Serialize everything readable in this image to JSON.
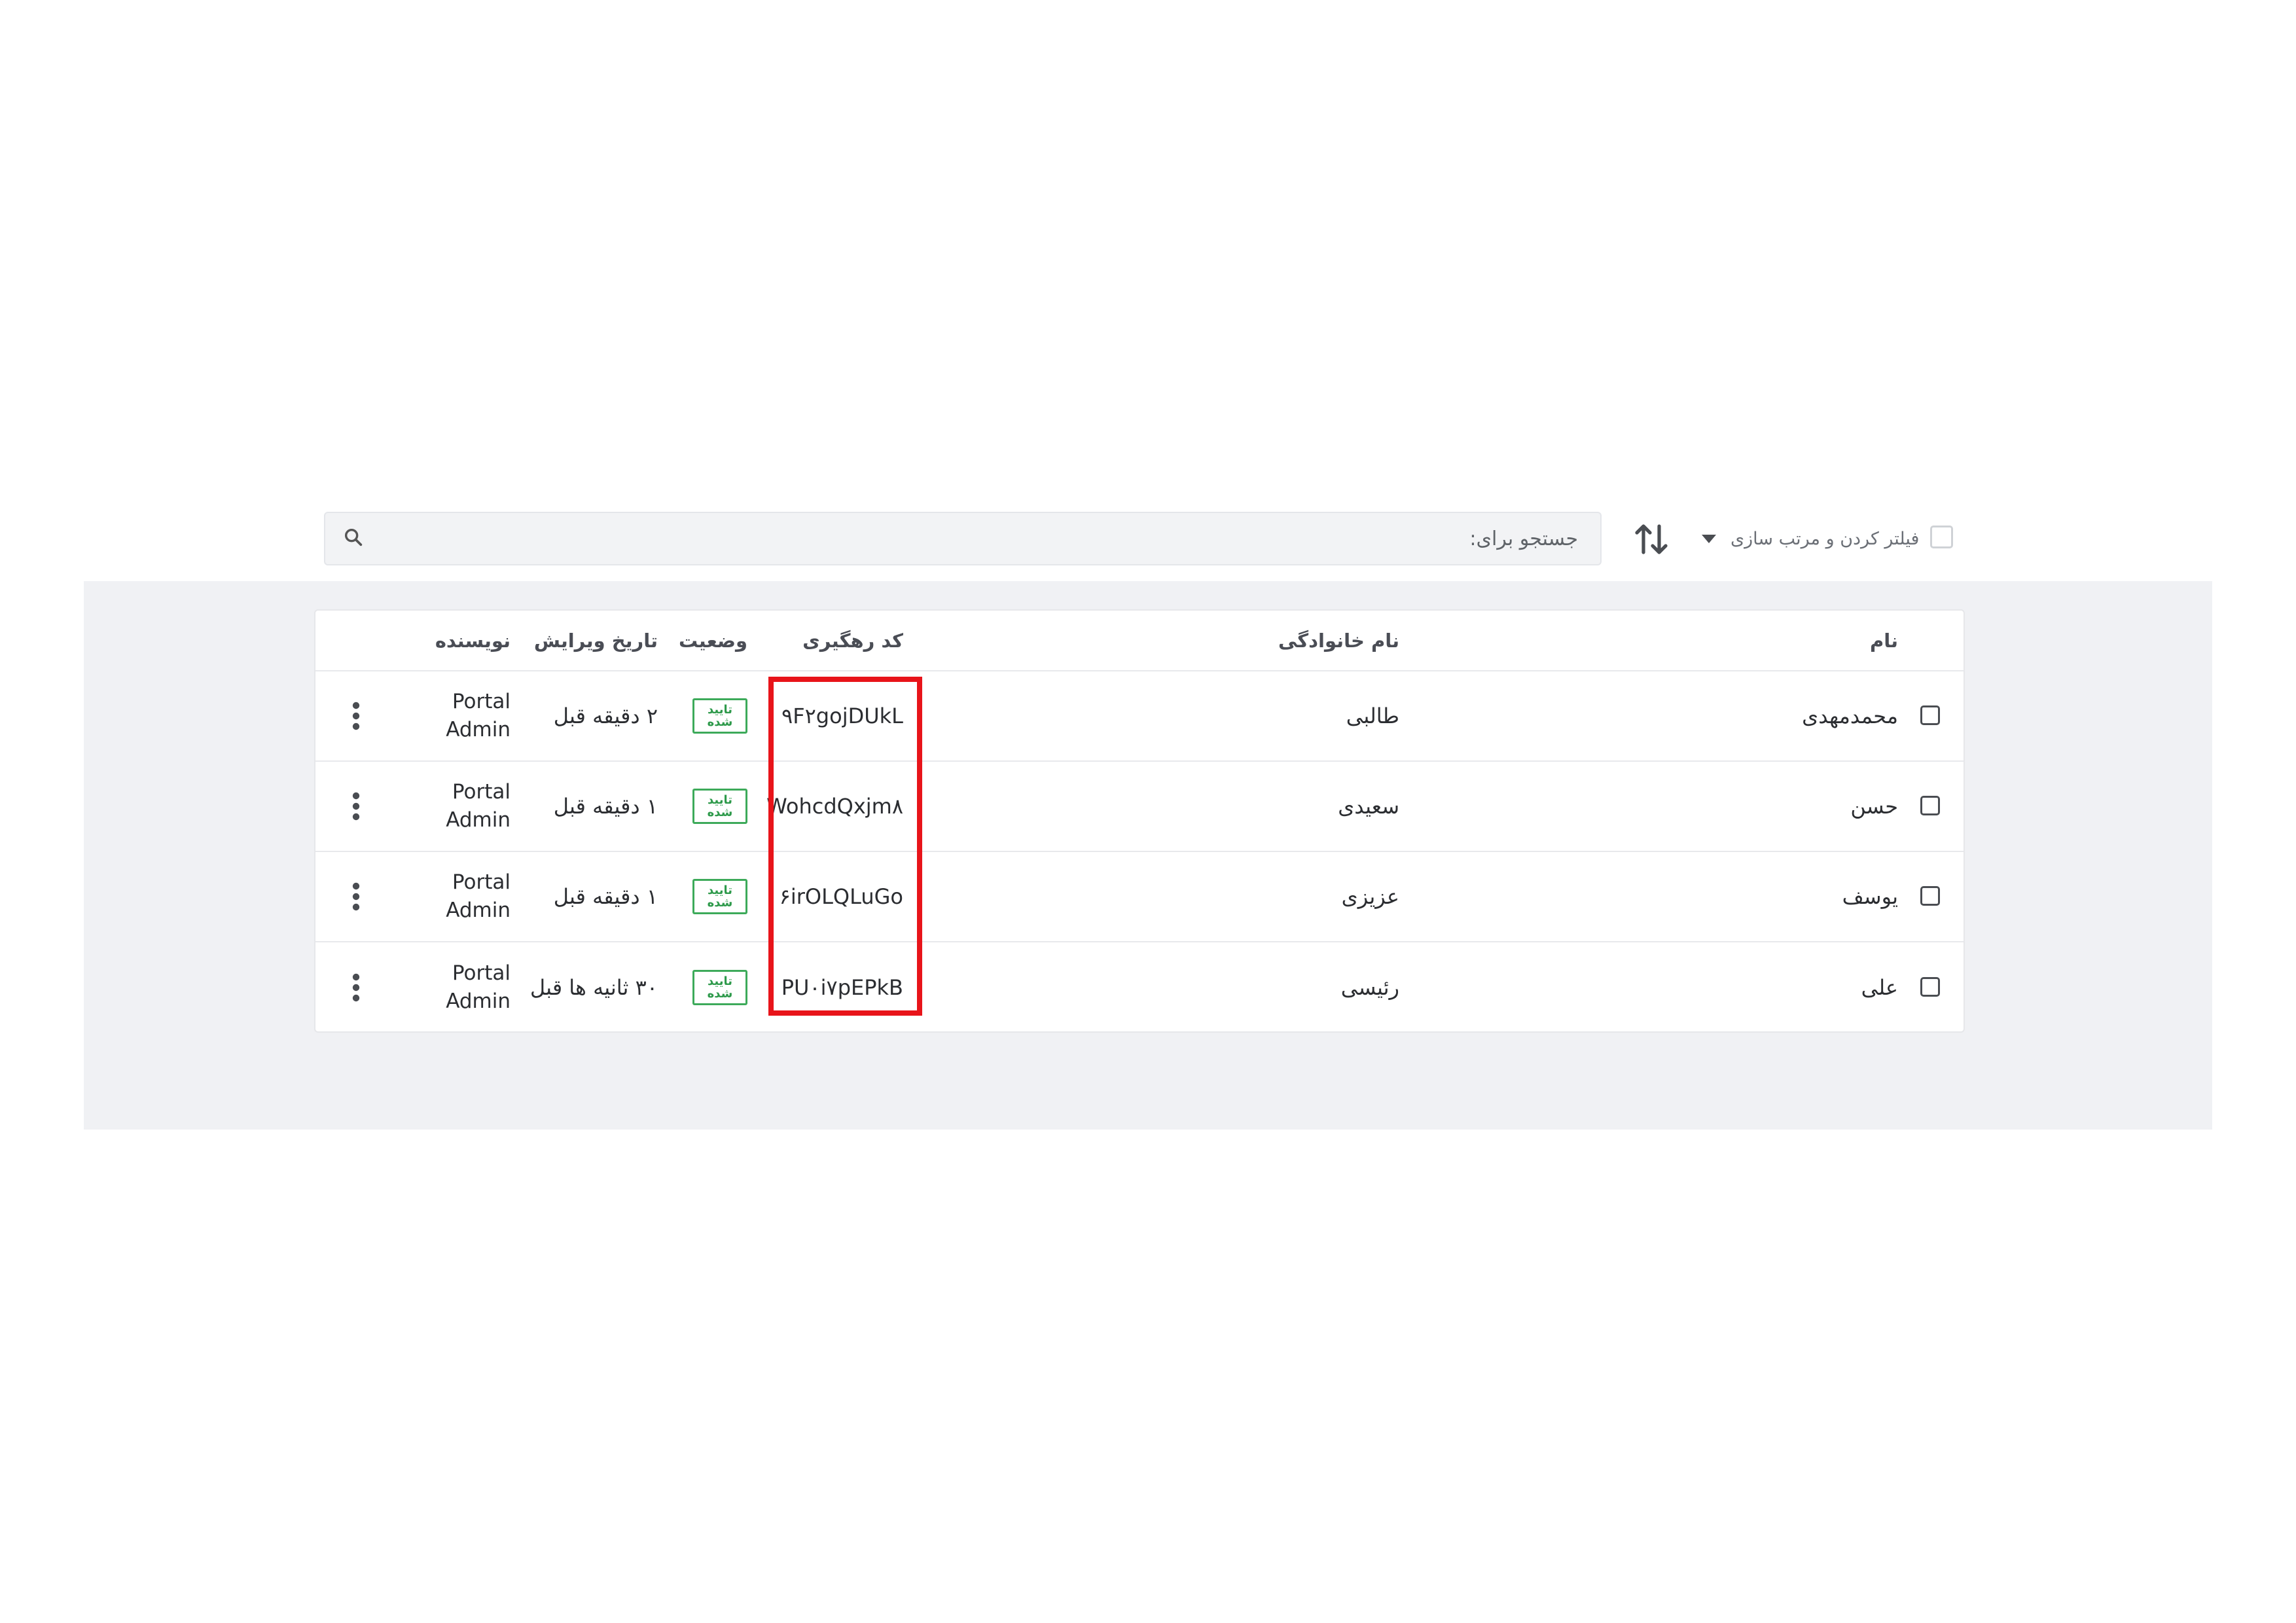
{
  "toolbar": {
    "search_placeholder": "جستجو برای:",
    "filter_label": "فیلتر کردن و مرتب سازی"
  },
  "table": {
    "headers": {
      "name": "نام",
      "family": "نام خانوادگی",
      "code": "کد رهگیری",
      "status": "وضعیت",
      "date": "تاریخ ویرایش",
      "author": "نویسنده"
    },
    "rows": [
      {
        "name": "محمدمهدی",
        "family": "طالبی",
        "code": "۹F۲gojDUkL",
        "status_line1": "تایید",
        "status_line2": "شده",
        "date": "۲ دقیقه قبل",
        "author_line1": "Portal",
        "author_line2": "Admin"
      },
      {
        "name": "حسن",
        "family": "سعیدی",
        "code": "WohcdQxjm۸",
        "status_line1": "تایید",
        "status_line2": "شده",
        "date": "۱ دقیقه قبل",
        "author_line1": "Portal",
        "author_line2": "Admin"
      },
      {
        "name": "یوسف",
        "family": "عزیزی",
        "code": "۶irOLQLuGo",
        "status_line1": "تایید",
        "status_line2": "شده",
        "date": "۱ دقیقه قبل",
        "author_line1": "Portal",
        "author_line2": "Admin"
      },
      {
        "name": "علی",
        "family": "رئیسی",
        "code": "PU۰i۷pEPkB",
        "status_line1": "تایید",
        "status_line2": "شده",
        "date": "۳۰ ثانیه ها قبل",
        "author_line1": "Portal",
        "author_line2": "Admin"
      }
    ]
  },
  "colors": {
    "highlight": "#e8141a",
    "status_green": "#3daa5a",
    "backdrop": "#f0f1f4"
  },
  "icons": [
    "search-icon",
    "sort-icon",
    "caret-down-icon",
    "more-vertical-icon"
  ]
}
